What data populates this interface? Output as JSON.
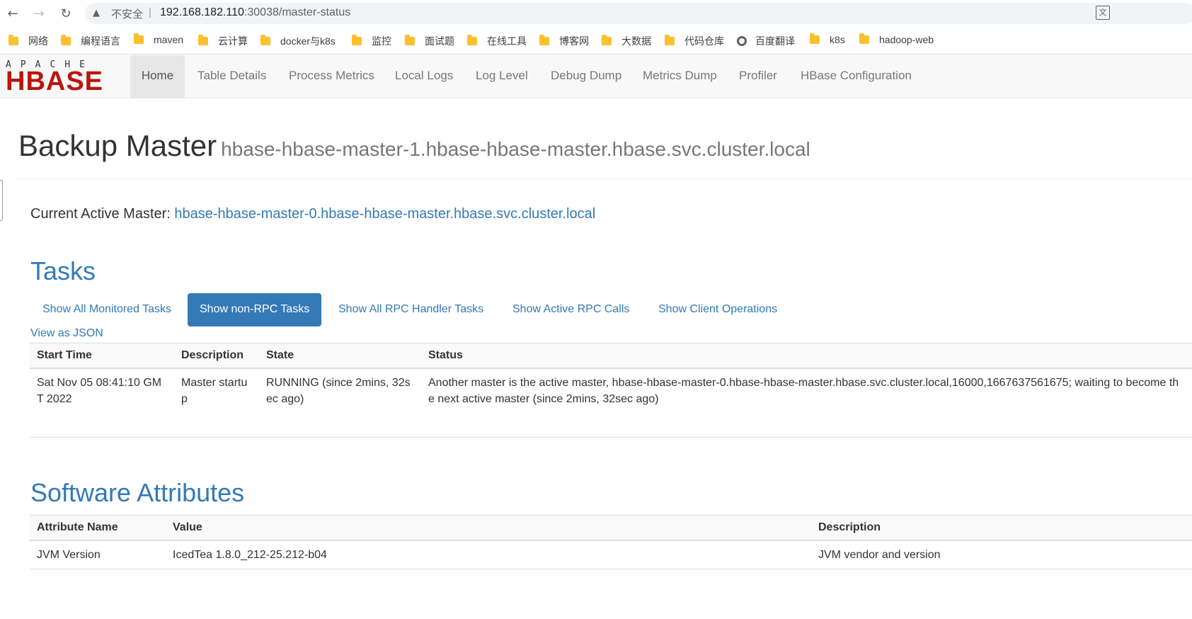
{
  "browser": {
    "insecure_label": "不安全",
    "separator": "|",
    "url_host": "192.168.182.110",
    "url_port_path": ":30038/master-status",
    "bookmarks": [
      "网络",
      "编程语言",
      "maven",
      "云计算",
      "docker与k8s",
      "监控",
      "面试题",
      "在线工具",
      "博客网",
      "大数据",
      "代码仓库",
      "百度翻译",
      "k8s",
      "hadoop-web"
    ]
  },
  "navbar": {
    "logo_top": "APACHE",
    "logo_main": "HBASE",
    "items": [
      "Home",
      "Table Details",
      "Process Metrics",
      "Local Logs",
      "Log Level",
      "Debug Dump",
      "Metrics Dump",
      "Profiler",
      "HBase Configuration"
    ]
  },
  "header": {
    "title": "Backup Master",
    "subtitle": "hbase-hbase-master-1.hbase-hbase-master.hbase.svc.cluster.local"
  },
  "active_master": {
    "label": "Current Active Master: ",
    "value": "hbase-hbase-master-0.hbase-hbase-master.hbase.svc.cluster.local"
  },
  "tasks": {
    "title": "Tasks",
    "tabs": [
      "Show All Monitored Tasks",
      "Show non-RPC Tasks",
      "Show All RPC Handler Tasks",
      "Show Active RPC Calls",
      "Show Client Operations"
    ],
    "view_json": "View as JSON",
    "columns": [
      "Start Time",
      "Description",
      "State",
      "Status"
    ],
    "rows": [
      {
        "start_time": "Sat Nov 05 08:41:10 GMT 2022",
        "description": "Master startup",
        "state": "RUNNING (since 2mins, 32sec ago)",
        "status": "Another master is the active master, hbase-hbase-master-0.hbase-hbase-master.hbase.svc.cluster.local,16000,1667637561675; waiting to become the next active master (since 2mins, 32sec ago)"
      }
    ]
  },
  "software": {
    "title": "Software Attributes",
    "columns": [
      "Attribute Name",
      "Value",
      "Description"
    ],
    "rows": [
      {
        "name": "JVM Version",
        "value": "IcedTea 1.8.0_212-25.212-b04",
        "description": "JVM vendor and version"
      }
    ]
  }
}
